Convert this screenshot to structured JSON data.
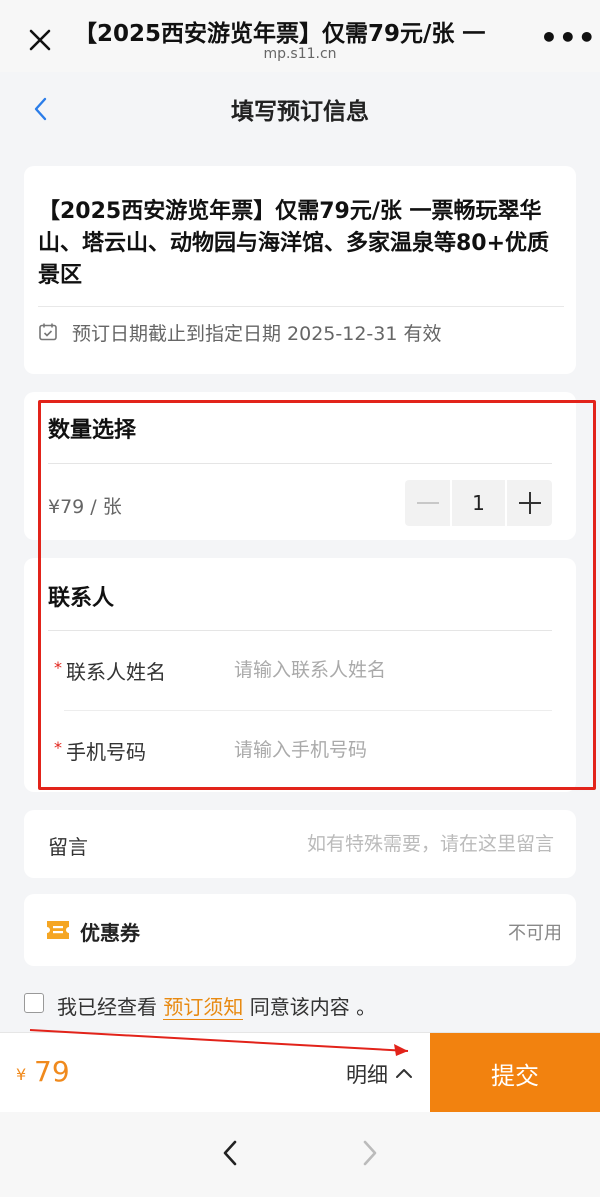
{
  "browser": {
    "title": "【2025西安游览年票】仅需79元/张 一",
    "domain": "mp.s11.cn",
    "more_label": "•••"
  },
  "page": {
    "title": "填写预订信息"
  },
  "product": {
    "title": "【2025西安游览年票】仅需79元/张 一票畅玩翠华山、塔云山、动物园与海洋馆、多家温泉等80+优质景区",
    "validity": "预订日期截止到指定日期 2025-12-31 有效"
  },
  "quantity": {
    "heading": "数量选择",
    "unit_price": "¥79 / 张",
    "value": "1"
  },
  "contact": {
    "heading": "联系人",
    "required_mark": "*",
    "name_label": "联系人姓名",
    "name_placeholder": "请输入联系人姓名",
    "phone_label": "手机号码",
    "phone_placeholder": "请输入手机号码"
  },
  "message": {
    "label": "留言",
    "placeholder": "如有特殊需要，请在这里留言"
  },
  "coupon": {
    "label": "优惠券",
    "status": "不可用"
  },
  "agreement": {
    "prefix": "我已经查看",
    "link": "预订须知",
    "suffix": "同意该内容 。"
  },
  "footer": {
    "currency": "¥",
    "total": "79",
    "details_label": "明细",
    "submit_label": "提交"
  },
  "colors": {
    "accent": "#f2820f",
    "annotation": "#e2231a"
  },
  "icons": [
    "close-icon",
    "more-icon",
    "back-chevron-icon",
    "calendar-icon",
    "minus-icon",
    "plus-icon",
    "coupon-icon",
    "chevron-up-icon",
    "nav-back-icon",
    "nav-forward-icon"
  ]
}
